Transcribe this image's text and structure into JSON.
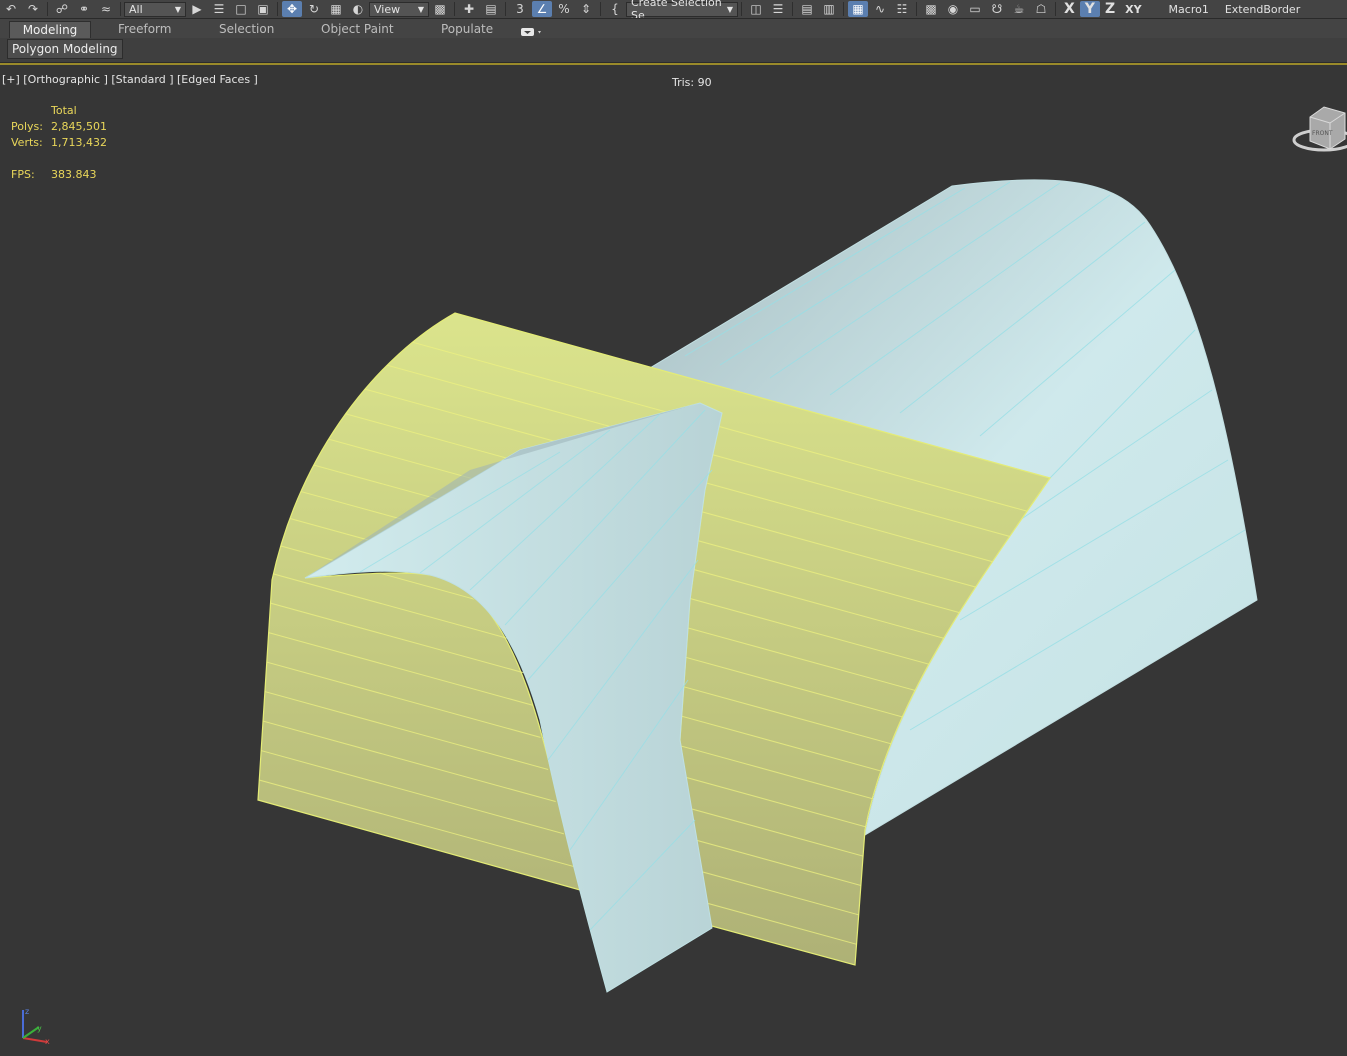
{
  "toolbar": {
    "selection_filter": "All",
    "reference_coord": "View",
    "named_selection": "Create Selection Se",
    "axes": [
      "X",
      "Y",
      "Z",
      "XY"
    ],
    "macro1": "Macro1",
    "extend_border": "ExtendBorder",
    "snap_label": "3",
    "percent_label": "%"
  },
  "ribbon": {
    "tabs": [
      "Modeling",
      "Freeform",
      "Selection",
      "Object Paint",
      "Populate"
    ],
    "active_tab": "Modeling",
    "panel_label": "Polygon Modeling"
  },
  "viewport": {
    "label": "[+] [Orthographic ] [Standard ] [Edged Faces ]",
    "tris": "Tris: 90",
    "stats": {
      "header": "Total",
      "polys_label": "Polys:",
      "polys": "2,845,501",
      "verts_label": "Verts:",
      "verts": "1,713,432",
      "fps_label": "FPS:",
      "fps": "383.843"
    },
    "viewcube_face": "FRONT"
  },
  "colors": {
    "viewport_bg": "#363636",
    "selected_mesh": "#d2de84",
    "mesh": "#c6e6e8",
    "stats_text": "#e9d75a",
    "active_button": "#5b7fb0",
    "viewport_border": "#9a8a2a"
  }
}
